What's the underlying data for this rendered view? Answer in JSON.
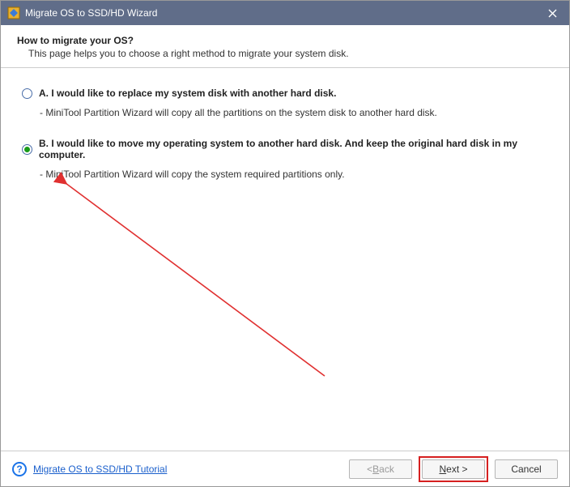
{
  "window": {
    "title": "Migrate OS to SSD/HD Wizard"
  },
  "header": {
    "title": "How to migrate your OS?",
    "subtitle": "This page helps you to choose a right method to migrate your system disk."
  },
  "options": {
    "a": {
      "label": "A. I would like to replace my system disk with another hard disk.",
      "desc": "- MiniTool Partition Wizard will copy all the partitions on the system disk to another hard disk.",
      "selected": false
    },
    "b": {
      "label": "B. I would like to move my operating system to another hard disk. And keep the original hard disk in my computer.",
      "desc": "- MiniTool Partition Wizard will copy the system required partitions only.",
      "selected": true
    }
  },
  "footer": {
    "tutorial_link": "Migrate OS to SSD/HD Tutorial",
    "back_prefix": "< ",
    "back_ul": "B",
    "back_suffix": "ack",
    "next_ul": "N",
    "next_suffix": "ext >",
    "cancel": "Cancel"
  }
}
